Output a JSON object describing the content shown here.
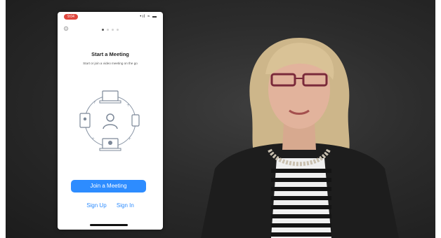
{
  "phone": {
    "status_time": "9:04",
    "status_icons": "•ıl ≈ ▬",
    "settings_icon": "gear-icon",
    "title": "Start a Meeting",
    "subtitle": "Start or join a video meeting on the go",
    "join_label": "Join a Meeting",
    "signup_label": "Sign Up",
    "signin_label": "Sign In",
    "accent": "#2d8cff"
  }
}
